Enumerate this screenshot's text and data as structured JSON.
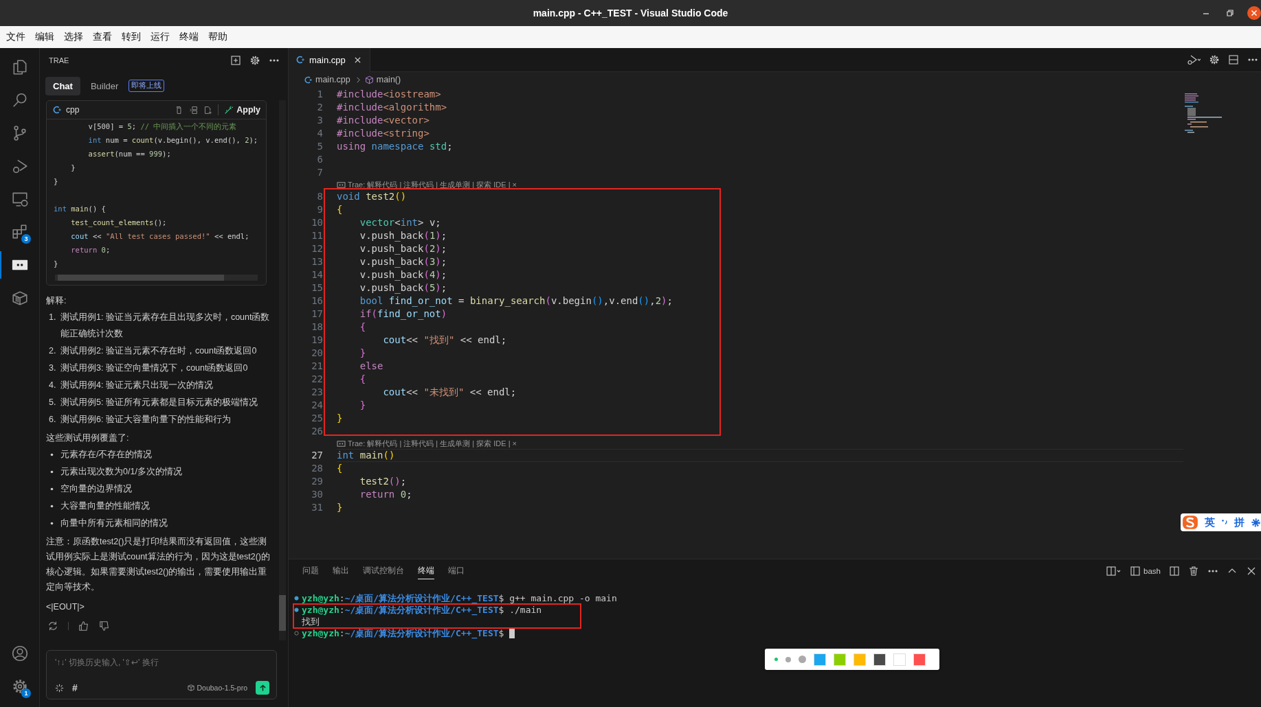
{
  "window": {
    "title": "main.cpp - C++_TEST - Visual Studio Code"
  },
  "menu": [
    "文件",
    "编辑",
    "选择",
    "查看",
    "转到",
    "运行",
    "终端",
    "帮助"
  ],
  "activity_bar": {
    "items": [
      {
        "kind": "files",
        "selected": false
      },
      {
        "kind": "search",
        "selected": false
      },
      {
        "kind": "source-control",
        "selected": false
      },
      {
        "kind": "run-debug",
        "selected": false
      },
      {
        "kind": "remote",
        "selected": false
      },
      {
        "kind": "extensions",
        "selected": false,
        "badge": "3"
      },
      {
        "kind": "chat",
        "selected": true
      },
      {
        "kind": "package",
        "selected": false
      }
    ],
    "bottom": [
      {
        "kind": "account"
      },
      {
        "kind": "settings",
        "badge": "1"
      }
    ]
  },
  "side_panel": {
    "title": "TRAE",
    "tabs": [
      {
        "label": "Chat",
        "selected": true
      },
      {
        "label": "Builder",
        "selected": false,
        "badge": "即将上线"
      }
    ],
    "code_block": {
      "language": "cpp",
      "action": "Apply",
      "blocks": [
        [
          [
            {
              "text": "        v[500] = ",
              "kind": "plain"
            },
            {
              "text": "5",
              "kind": "num"
            },
            {
              "text": "; ",
              "kind": "plain"
            },
            {
              "text": "// 中间插入一个不同的元素",
              "kind": "cmt"
            }
          ],
          [
            {
              "text": "        int",
              "kind": "kw"
            },
            {
              "text": " num = ",
              "kind": "plain"
            },
            {
              "text": "count",
              "kind": "fn"
            },
            {
              "text": "(v.begin(), v.end(), ",
              "kind": "plain"
            },
            {
              "text": "2",
              "kind": "num"
            },
            {
              "text": ");",
              "kind": "plain"
            }
          ],
          [
            {
              "text": "        assert",
              "kind": "fn"
            },
            {
              "text": "(num == ",
              "kind": "plain"
            },
            {
              "text": "999",
              "kind": "num"
            },
            {
              "text": ");",
              "kind": "plain"
            }
          ],
          [
            {
              "text": "    }",
              "kind": "plain"
            }
          ],
          [
            {
              "text": "}",
              "kind": "plain"
            }
          ]
        ],
        [
          [
            {
              "text": "int",
              "kind": "kw"
            },
            {
              "text": " main",
              "kind": "fn"
            },
            {
              "text": "() {",
              "kind": "plain"
            }
          ],
          [
            {
              "text": "    test_count_elements",
              "kind": "fn"
            },
            {
              "text": "();",
              "kind": "plain"
            }
          ],
          [
            {
              "text": "    cout",
              "kind": "var"
            },
            {
              "text": " << ",
              "kind": "plain"
            },
            {
              "text": "\"All test cases passed!\"",
              "kind": "str"
            },
            {
              "text": " << endl;",
              "kind": "plain"
            }
          ],
          [
            {
              "text": "    return",
              "kind": "ctrl"
            },
            {
              "text": " 0",
              "kind": "num"
            },
            {
              "text": ";",
              "kind": "plain"
            }
          ],
          [
            {
              "text": "}",
              "kind": "plain"
            }
          ]
        ]
      ]
    },
    "explanation": {
      "heading": "解释:",
      "steps": [
        {
          "number": "1.",
          "text": "测试用例1: 验证当元素存在且出现多次时，count函数能正确统计次数"
        },
        {
          "number": "2.",
          "text": "测试用例2: 验证当元素不存在时，count函数返回0"
        },
        {
          "number": "3.",
          "text": "测试用例3: 验证空向量情况下，count函数返回0"
        },
        {
          "number": "4.",
          "text": "测试用例4: 验证元素只出现一次的情况"
        },
        {
          "number": "5.",
          "text": "测试用例5: 验证所有元素都是目标元素的极端情况"
        },
        {
          "number": "6.",
          "text": "测试用例6: 验证大容量向量下的性能和行为"
        }
      ],
      "coverage_heading": "这些测试用例覆盖了:",
      "coverage": [
        "元素存在/不存在的情况",
        "元素出现次数为0/1/多次的情况",
        "空向量的边界情况",
        "大容量向量的性能情况",
        "向量中所有元素相同的情况"
      ],
      "note": "注意：原函数test2()只是打印结果而没有返回值，这些测试用例实际上是测试count算法的行为，因为这是test2()的核心逻辑。如果需要测试test2()的输出，需要使用输出重定向等技术。",
      "end_marker": "<|EOUT|>"
    },
    "input": {
      "placeholder": "'↑↓' 切换历史输入, '⇧↩' 换行",
      "hash": "#",
      "model": "Doubao-1.5-pro"
    }
  },
  "editor": {
    "tabs": [
      {
        "label": "main.cpp",
        "selected": true
      }
    ],
    "breadcrumbs": [
      "main.cpp",
      "main()"
    ],
    "sections": [
      {
        "boxed": false,
        "lines": [
          {
            "kind": "code",
            "number": "1",
            "current": false,
            "tokens": [
              {
                "text": "#include",
                "kind": "pp"
              },
              {
                "text": "<iostream>",
                "kind": "str"
              }
            ]
          },
          {
            "kind": "code",
            "number": "2",
            "current": false,
            "tokens": [
              {
                "text": "#include",
                "kind": "pp"
              },
              {
                "text": "<algorithm>",
                "kind": "str"
              }
            ]
          },
          {
            "kind": "code",
            "number": "3",
            "current": false,
            "tokens": [
              {
                "text": "#include",
                "kind": "pp"
              },
              {
                "text": "<vector>",
                "kind": "str"
              }
            ]
          },
          {
            "kind": "code",
            "number": "4",
            "current": false,
            "tokens": [
              {
                "text": "#include",
                "kind": "pp"
              },
              {
                "text": "<string>",
                "kind": "str"
              }
            ]
          },
          {
            "kind": "code",
            "number": "5",
            "current": false,
            "tokens": [
              {
                "text": "using",
                "kind": "ctrl"
              },
              {
                "text": " namespace",
                "kind": "kw"
              },
              {
                "text": " std",
                "kind": "type"
              },
              {
                "text": ";",
                "kind": "plain"
              }
            ]
          },
          {
            "kind": "code",
            "number": "6",
            "current": false
          },
          {
            "kind": "code",
            "number": "7",
            "current": false
          },
          {
            "kind": "lens",
            "text": "Trae: 解释代码 | 注释代码 | 生成单测 | 探索 IDE | ×"
          }
        ]
      },
      {
        "boxed": true,
        "lines": [
          {
            "kind": "code",
            "number": "8",
            "current": false,
            "tokens": [
              {
                "text": "void",
                "kind": "kw"
              },
              {
                "text": " test2",
                "kind": "fn"
              },
              {
                "text": "()",
                "kind": "b1"
              }
            ]
          },
          {
            "kind": "code",
            "number": "9",
            "current": false,
            "tokens": [
              {
                "text": "{",
                "kind": "b1"
              }
            ]
          },
          {
            "kind": "code",
            "number": "10",
            "current": false,
            "tokens": [
              {
                "text": "    vector",
                "kind": "type"
              },
              {
                "text": "<",
                "kind": "plain"
              },
              {
                "text": "int",
                "kind": "kw"
              },
              {
                "text": "> v;",
                "kind": "plain"
              }
            ]
          },
          {
            "kind": "code",
            "number": "11",
            "current": false,
            "tokens": [
              {
                "text": "    v.push_back",
                "kind": "plain"
              },
              {
                "text": "(",
                "kind": "b2"
              },
              {
                "text": "1",
                "kind": "num"
              },
              {
                "text": ")",
                "kind": "b2"
              },
              {
                "text": ";",
                "kind": "plain"
              }
            ]
          },
          {
            "kind": "code",
            "number": "12",
            "current": false,
            "tokens": [
              {
                "text": "    v.push_back",
                "kind": "plain"
              },
              {
                "text": "(",
                "kind": "b2"
              },
              {
                "text": "2",
                "kind": "num"
              },
              {
                "text": ")",
                "kind": "b2"
              },
              {
                "text": ";",
                "kind": "plain"
              }
            ]
          },
          {
            "kind": "code",
            "number": "13",
            "current": false,
            "tokens": [
              {
                "text": "    v.push_back",
                "kind": "plain"
              },
              {
                "text": "(",
                "kind": "b2"
              },
              {
                "text": "3",
                "kind": "num"
              },
              {
                "text": ")",
                "kind": "b2"
              },
              {
                "text": ";",
                "kind": "plain"
              }
            ]
          },
          {
            "kind": "code",
            "number": "14",
            "current": false,
            "tokens": [
              {
                "text": "    v.push_back",
                "kind": "plain"
              },
              {
                "text": "(",
                "kind": "b2"
              },
              {
                "text": "4",
                "kind": "num"
              },
              {
                "text": ")",
                "kind": "b2"
              },
              {
                "text": ";",
                "kind": "plain"
              }
            ]
          },
          {
            "kind": "code",
            "number": "15",
            "current": false,
            "tokens": [
              {
                "text": "    v.push_back",
                "kind": "plain"
              },
              {
                "text": "(",
                "kind": "b2"
              },
              {
                "text": "5",
                "kind": "num"
              },
              {
                "text": ")",
                "kind": "b2"
              },
              {
                "text": ";",
                "kind": "plain"
              }
            ]
          },
          {
            "kind": "code",
            "number": "16",
            "current": false,
            "tokens": [
              {
                "text": "    bool",
                "kind": "kw"
              },
              {
                "text": " find_or_not",
                "kind": "var"
              },
              {
                "text": " = ",
                "kind": "plain"
              },
              {
                "text": "binary_search",
                "kind": "fn"
              },
              {
                "text": "(",
                "kind": "b2"
              },
              {
                "text": "v.begin",
                "kind": "plain"
              },
              {
                "text": "()",
                "kind": "b3"
              },
              {
                "text": ",v.end",
                "kind": "plain"
              },
              {
                "text": "()",
                "kind": "b3"
              },
              {
                "text": ",",
                "kind": "plain"
              },
              {
                "text": "2",
                "kind": "num"
              },
              {
                "text": ")",
                "kind": "b2"
              },
              {
                "text": ";",
                "kind": "plain"
              }
            ]
          },
          {
            "kind": "code",
            "number": "17",
            "current": false,
            "tokens": [
              {
                "text": "    if",
                "kind": "ctrl"
              },
              {
                "text": "(",
                "kind": "b2"
              },
              {
                "text": "find_or_not",
                "kind": "var"
              },
              {
                "text": ")",
                "kind": "b2"
              }
            ]
          },
          {
            "kind": "code",
            "number": "18",
            "current": false,
            "tokens": [
              {
                "text": "    {",
                "kind": "b2"
              }
            ]
          },
          {
            "kind": "code",
            "number": "19",
            "current": false,
            "tokens": [
              {
                "text": "        cout",
                "kind": "var"
              },
              {
                "text": "<< ",
                "kind": "plain"
              },
              {
                "text": "\"找到\"",
                "kind": "str"
              },
              {
                "text": " << endl;",
                "kind": "plain"
              }
            ]
          },
          {
            "kind": "code",
            "number": "20",
            "current": false,
            "tokens": [
              {
                "text": "    }",
                "kind": "b2"
              }
            ]
          },
          {
            "kind": "code",
            "number": "21",
            "current": false,
            "tokens": [
              {
                "text": "    else",
                "kind": "ctrl"
              }
            ]
          },
          {
            "kind": "code",
            "number": "22",
            "current": false,
            "tokens": [
              {
                "text": "    {",
                "kind": "b2"
              }
            ]
          },
          {
            "kind": "code",
            "number": "23",
            "current": false,
            "tokens": [
              {
                "text": "        cout",
                "kind": "var"
              },
              {
                "text": "<< ",
                "kind": "plain"
              },
              {
                "text": "\"未找到\"",
                "kind": "str"
              },
              {
                "text": " << endl;",
                "kind": "plain"
              }
            ]
          },
          {
            "kind": "code",
            "number": "24",
            "current": false,
            "tokens": [
              {
                "text": "    }",
                "kind": "b2"
              }
            ]
          },
          {
            "kind": "code",
            "number": "25",
            "current": false,
            "tokens": [
              {
                "text": "}",
                "kind": "b1"
              }
            ]
          },
          {
            "kind": "code",
            "number": "26",
            "current": false
          }
        ]
      },
      {
        "boxed": false,
        "lines": [
          {
            "kind": "lens",
            "text": "Trae: 解释代码 | 注释代码 | 生成单测 | 探索 IDE | ×"
          },
          {
            "kind": "code",
            "number": "27",
            "current": true,
            "tokens": [
              {
                "text": "int",
                "kind": "kw"
              },
              {
                "text": " main",
                "kind": "fn"
              },
              {
                "text": "()",
                "kind": "b1"
              }
            ]
          },
          {
            "kind": "code",
            "number": "28",
            "current": false,
            "tokens": [
              {
                "text": "{",
                "kind": "b1"
              }
            ]
          },
          {
            "kind": "code",
            "number": "29",
            "current": false,
            "tokens": [
              {
                "text": "    test2",
                "kind": "fn"
              },
              {
                "text": "()",
                "kind": "b2"
              },
              {
                "text": ";",
                "kind": "plain"
              }
            ]
          },
          {
            "kind": "code",
            "number": "30",
            "current": false,
            "tokens": [
              {
                "text": "    return",
                "kind": "ctrl"
              },
              {
                "text": " 0",
                "kind": "num"
              },
              {
                "text": ";",
                "kind": "plain"
              }
            ]
          },
          {
            "kind": "code",
            "number": "31",
            "current": false,
            "tokens": [
              {
                "text": "}",
                "kind": "b1"
              }
            ]
          }
        ]
      }
    ]
  },
  "panel": {
    "tabs": [
      {
        "label": "问题",
        "selected": false
      },
      {
        "label": "输出",
        "selected": false
      },
      {
        "label": "调试控制台",
        "selected": false
      },
      {
        "label": "终端",
        "selected": true
      },
      {
        "label": "端口",
        "selected": false
      }
    ],
    "shell": "bash",
    "blocks": [
      {
        "boxed": false,
        "lines": [
          {
            "kind": "prompt",
            "finished": true,
            "user": "yzh@yzh",
            "separator": ":",
            "path": "~/桌面/算法分析设计作业/C++_TEST",
            "sign": "$",
            "command": "g++ main.cpp -o main"
          }
        ]
      },
      {
        "boxed": true,
        "lines": [
          {
            "kind": "prompt",
            "finished": true,
            "user": "yzh@yzh",
            "separator": ":",
            "path": "~/桌面/算法分析设计作业/C++_TEST",
            "sign": "$",
            "command": "./main"
          },
          {
            "kind": "output",
            "text": "找到"
          }
        ]
      },
      {
        "boxed": false,
        "lines": [
          {
            "kind": "prompt",
            "finished": false,
            "user": "yzh@yzh",
            "separator": ":",
            "path": "~/桌面/算法分析设计作业/C++_TEST",
            "sign": "$"
          }
        ]
      }
    ]
  },
  "color_picker": {
    "sizes": [
      {
        "selected": true
      },
      {
        "selected": false
      },
      {
        "selected": false
      }
    ],
    "colors": [
      {
        "color": "#1aa7f0"
      },
      {
        "color": "#8ccf00"
      },
      {
        "color": "#ffb900"
      },
      {
        "color": "#4b4b4b"
      },
      {
        "color": "#ffffff"
      },
      {
        "color": "#ff4f4f"
      }
    ]
  },
  "ime": {
    "mode": "英",
    "input": "拼"
  }
}
